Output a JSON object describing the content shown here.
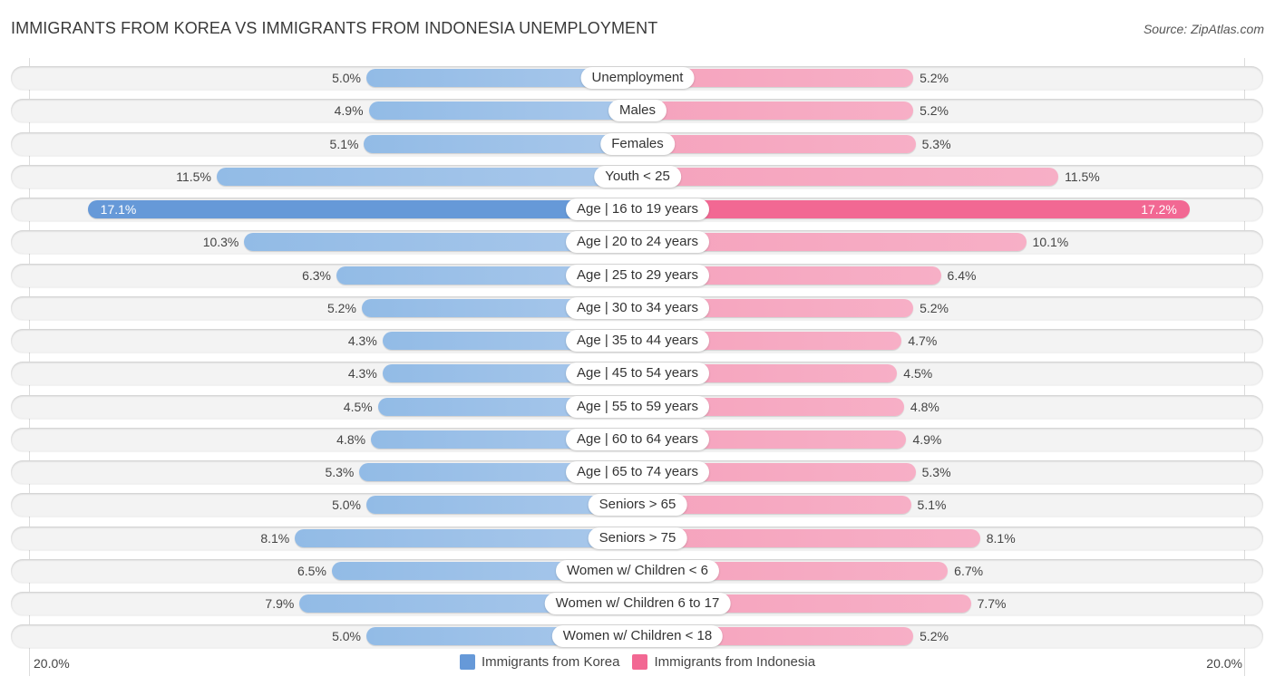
{
  "title": "IMMIGRANTS FROM KOREA VS IMMIGRANTS FROM INDONESIA UNEMPLOYMENT",
  "source": "Source: ZipAtlas.com",
  "colors": {
    "korea": "#6699d8",
    "indonesia": "#f26893"
  },
  "chart_data": {
    "type": "bar",
    "orientation": "horizontal-diverging",
    "title": "IMMIGRANTS FROM KOREA VS IMMIGRANTS FROM INDONESIA UNEMPLOYMENT",
    "categories": [
      "Unemployment",
      "Males",
      "Females",
      "Youth < 25",
      "Age | 16 to 19 years",
      "Age | 20 to 24 years",
      "Age | 25 to 29 years",
      "Age | 30 to 34 years",
      "Age | 35 to 44 years",
      "Age | 45 to 54 years",
      "Age | 55 to 59 years",
      "Age | 60 to 64 years",
      "Age | 65 to 74 years",
      "Seniors > 65",
      "Seniors > 75",
      "Women w/ Children < 6",
      "Women w/ Children 6 to 17",
      "Women w/ Children < 18"
    ],
    "series": [
      {
        "name": "Immigrants from Korea",
        "side": "left",
        "values": [
          5.0,
          4.9,
          5.1,
          11.5,
          17.1,
          10.3,
          6.3,
          5.2,
          4.3,
          4.3,
          4.5,
          4.8,
          5.3,
          5.0,
          8.1,
          6.5,
          7.9,
          5.0
        ],
        "labels": [
          "5.0%",
          "4.9%",
          "5.1%",
          "11.5%",
          "17.1%",
          "10.3%",
          "6.3%",
          "5.2%",
          "4.3%",
          "4.3%",
          "4.5%",
          "4.8%",
          "5.3%",
          "5.0%",
          "8.1%",
          "6.5%",
          "7.9%",
          "5.0%"
        ]
      },
      {
        "name": "Immigrants from Indonesia",
        "side": "right",
        "values": [
          5.2,
          5.2,
          5.3,
          11.5,
          17.2,
          10.1,
          6.4,
          5.2,
          4.7,
          4.5,
          4.8,
          4.9,
          5.3,
          5.1,
          8.1,
          6.7,
          7.7,
          5.2
        ],
        "labels": [
          "5.2%",
          "5.2%",
          "5.3%",
          "11.5%",
          "17.2%",
          "10.1%",
          "6.4%",
          "5.2%",
          "4.7%",
          "4.5%",
          "4.8%",
          "4.9%",
          "5.3%",
          "5.1%",
          "8.1%",
          "6.7%",
          "7.7%",
          "5.2%"
        ]
      }
    ],
    "highlight_index": 4,
    "xlim": [
      0,
      20.0
    ],
    "axis_labels": {
      "left": "20.0%",
      "right": "20.0%"
    },
    "legend": [
      "Immigrants from Korea",
      "Immigrants from Indonesia"
    ],
    "legend_position": "bottom-center",
    "unit": "%"
  }
}
